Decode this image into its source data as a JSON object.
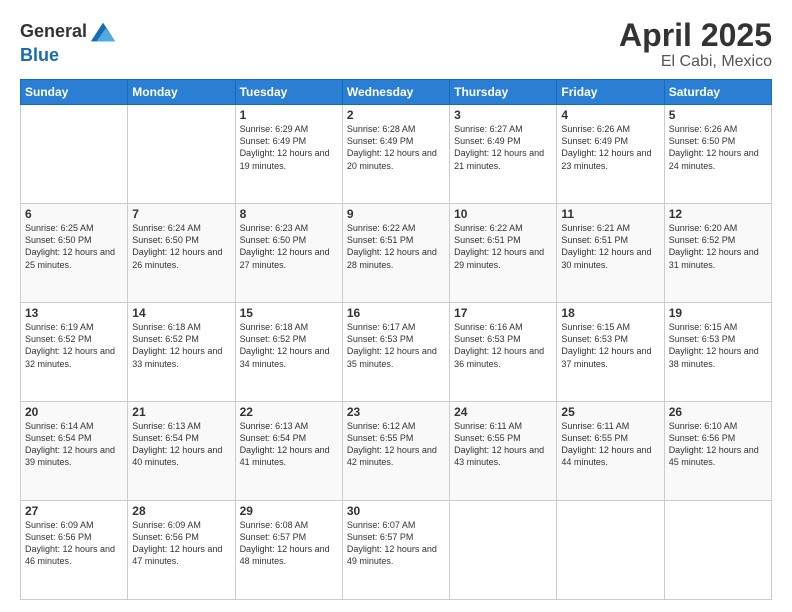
{
  "header": {
    "logo_line1": "General",
    "logo_line2": "Blue",
    "title": "April 2025",
    "subtitle": "El Cabi, Mexico"
  },
  "days_of_week": [
    "Sunday",
    "Monday",
    "Tuesday",
    "Wednesday",
    "Thursday",
    "Friday",
    "Saturday"
  ],
  "weeks": [
    [
      {
        "day": null
      },
      {
        "day": null
      },
      {
        "day": 1,
        "sunrise": "6:29 AM",
        "sunset": "6:49 PM",
        "daylight": "12 hours and 19 minutes."
      },
      {
        "day": 2,
        "sunrise": "6:28 AM",
        "sunset": "6:49 PM",
        "daylight": "12 hours and 20 minutes."
      },
      {
        "day": 3,
        "sunrise": "6:27 AM",
        "sunset": "6:49 PM",
        "daylight": "12 hours and 21 minutes."
      },
      {
        "day": 4,
        "sunrise": "6:26 AM",
        "sunset": "6:49 PM",
        "daylight": "12 hours and 23 minutes."
      },
      {
        "day": 5,
        "sunrise": "6:26 AM",
        "sunset": "6:50 PM",
        "daylight": "12 hours and 24 minutes."
      }
    ],
    [
      {
        "day": 6,
        "sunrise": "6:25 AM",
        "sunset": "6:50 PM",
        "daylight": "12 hours and 25 minutes."
      },
      {
        "day": 7,
        "sunrise": "6:24 AM",
        "sunset": "6:50 PM",
        "daylight": "12 hours and 26 minutes."
      },
      {
        "day": 8,
        "sunrise": "6:23 AM",
        "sunset": "6:50 PM",
        "daylight": "12 hours and 27 minutes."
      },
      {
        "day": 9,
        "sunrise": "6:22 AM",
        "sunset": "6:51 PM",
        "daylight": "12 hours and 28 minutes."
      },
      {
        "day": 10,
        "sunrise": "6:22 AM",
        "sunset": "6:51 PM",
        "daylight": "12 hours and 29 minutes."
      },
      {
        "day": 11,
        "sunrise": "6:21 AM",
        "sunset": "6:51 PM",
        "daylight": "12 hours and 30 minutes."
      },
      {
        "day": 12,
        "sunrise": "6:20 AM",
        "sunset": "6:52 PM",
        "daylight": "12 hours and 31 minutes."
      }
    ],
    [
      {
        "day": 13,
        "sunrise": "6:19 AM",
        "sunset": "6:52 PM",
        "daylight": "12 hours and 32 minutes."
      },
      {
        "day": 14,
        "sunrise": "6:18 AM",
        "sunset": "6:52 PM",
        "daylight": "12 hours and 33 minutes."
      },
      {
        "day": 15,
        "sunrise": "6:18 AM",
        "sunset": "6:52 PM",
        "daylight": "12 hours and 34 minutes."
      },
      {
        "day": 16,
        "sunrise": "6:17 AM",
        "sunset": "6:53 PM",
        "daylight": "12 hours and 35 minutes."
      },
      {
        "day": 17,
        "sunrise": "6:16 AM",
        "sunset": "6:53 PM",
        "daylight": "12 hours and 36 minutes."
      },
      {
        "day": 18,
        "sunrise": "6:15 AM",
        "sunset": "6:53 PM",
        "daylight": "12 hours and 37 minutes."
      },
      {
        "day": 19,
        "sunrise": "6:15 AM",
        "sunset": "6:53 PM",
        "daylight": "12 hours and 38 minutes."
      }
    ],
    [
      {
        "day": 20,
        "sunrise": "6:14 AM",
        "sunset": "6:54 PM",
        "daylight": "12 hours and 39 minutes."
      },
      {
        "day": 21,
        "sunrise": "6:13 AM",
        "sunset": "6:54 PM",
        "daylight": "12 hours and 40 minutes."
      },
      {
        "day": 22,
        "sunrise": "6:13 AM",
        "sunset": "6:54 PM",
        "daylight": "12 hours and 41 minutes."
      },
      {
        "day": 23,
        "sunrise": "6:12 AM",
        "sunset": "6:55 PM",
        "daylight": "12 hours and 42 minutes."
      },
      {
        "day": 24,
        "sunrise": "6:11 AM",
        "sunset": "6:55 PM",
        "daylight": "12 hours and 43 minutes."
      },
      {
        "day": 25,
        "sunrise": "6:11 AM",
        "sunset": "6:55 PM",
        "daylight": "12 hours and 44 minutes."
      },
      {
        "day": 26,
        "sunrise": "6:10 AM",
        "sunset": "6:56 PM",
        "daylight": "12 hours and 45 minutes."
      }
    ],
    [
      {
        "day": 27,
        "sunrise": "6:09 AM",
        "sunset": "6:56 PM",
        "daylight": "12 hours and 46 minutes."
      },
      {
        "day": 28,
        "sunrise": "6:09 AM",
        "sunset": "6:56 PM",
        "daylight": "12 hours and 47 minutes."
      },
      {
        "day": 29,
        "sunrise": "6:08 AM",
        "sunset": "6:57 PM",
        "daylight": "12 hours and 48 minutes."
      },
      {
        "day": 30,
        "sunrise": "6:07 AM",
        "sunset": "6:57 PM",
        "daylight": "12 hours and 49 minutes."
      },
      {
        "day": null
      },
      {
        "day": null
      },
      {
        "day": null
      }
    ]
  ]
}
